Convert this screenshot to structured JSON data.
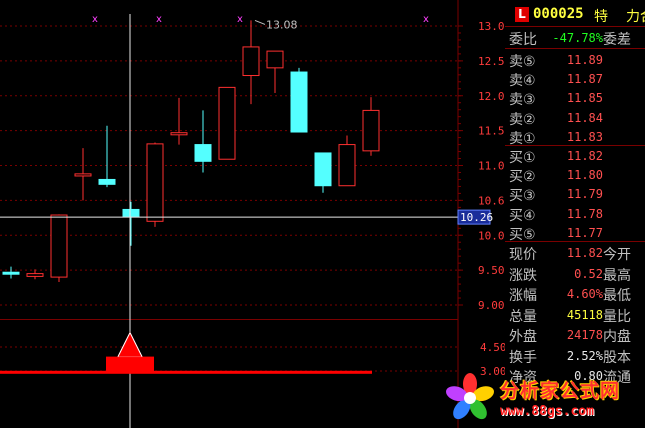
{
  "chart_data": [
    {
      "type": "candlestick",
      "title": "",
      "ylim": [
        8.7,
        13.2
      ],
      "y_ticks": [
        13.0,
        12.5,
        12.0,
        11.5,
        11.0,
        10.5,
        10.0,
        9.5,
        9.0
      ],
      "y_tick_labels": [
        "13.00",
        "12.50",
        "12.00",
        "11.50",
        "11.00",
        "10.60",
        "10.00",
        "9.50",
        "9.00"
      ],
      "crosshair_value": "10.26",
      "high_annotation": "13.08",
      "candles": [
        {
          "o": 9.47,
          "c": 9.47,
          "h": 9.55,
          "l": 9.38,
          "dir": "down"
        },
        {
          "o": 9.41,
          "c": 9.45,
          "h": 9.51,
          "l": 9.37,
          "dir": "up"
        },
        {
          "o": 9.4,
          "c": 10.29,
          "h": 10.3,
          "l": 9.33,
          "dir": "up"
        },
        {
          "o": 10.85,
          "c": 10.88,
          "h": 11.25,
          "l": 10.5,
          "dir": "up"
        },
        {
          "o": 10.8,
          "c": 10.73,
          "h": 11.57,
          "l": 10.69,
          "dir": "down"
        },
        {
          "o": 10.37,
          "c": 10.27,
          "h": 10.48,
          "l": 9.85,
          "dir": "down"
        },
        {
          "o": 10.2,
          "c": 11.31,
          "h": 11.33,
          "l": 10.12,
          "dir": "up"
        },
        {
          "o": 11.44,
          "c": 11.47,
          "h": 11.97,
          "l": 11.3,
          "dir": "up"
        },
        {
          "o": 11.3,
          "c": 11.06,
          "h": 11.79,
          "l": 10.9,
          "dir": "down"
        },
        {
          "o": 11.09,
          "c": 12.12,
          "h": 12.12,
          "l": 11.09,
          "dir": "up"
        },
        {
          "o": 12.29,
          "c": 12.7,
          "h": 13.08,
          "l": 11.88,
          "dir": "up"
        },
        {
          "o": 12.4,
          "c": 12.64,
          "h": 12.64,
          "l": 12.04,
          "dir": "up"
        },
        {
          "o": 12.34,
          "c": 11.48,
          "h": 12.4,
          "l": 11.48,
          "dir": "down"
        },
        {
          "o": 11.18,
          "c": 10.71,
          "h": 11.18,
          "l": 10.61,
          "dir": "down"
        },
        {
          "o": 10.71,
          "c": 11.3,
          "h": 11.43,
          "l": 10.71,
          "dir": "up"
        },
        {
          "o": 11.21,
          "c": 11.79,
          "h": 11.98,
          "l": 11.14,
          "dir": "up"
        }
      ],
      "markers": [
        {
          "index": 2,
          "symbol": "x"
        },
        {
          "index": 7,
          "symbol": "x"
        },
        {
          "index": 10,
          "symbol": "x"
        },
        {
          "index": 18,
          "symbol": "x"
        }
      ]
    },
    {
      "type": "indicator",
      "ylim": [
        2.8,
        5.6
      ],
      "y_tick_labels": [
        "4.50",
        "3.00"
      ],
      "y_ticks": [
        4.5,
        3.0
      ],
      "peak": 5.4,
      "plateau": 3.9,
      "base": 2.95
    }
  ],
  "panel": {
    "stock_code": "000025",
    "stock_flag": "特",
    "stock_name": "力合",
    "badge": "L",
    "weibi_label": "委比",
    "weibi_value": "-47.78%",
    "weicha_label": "委差",
    "sell": [
      {
        "label": "卖⑤",
        "price": "11.89"
      },
      {
        "label": "卖④",
        "price": "11.87"
      },
      {
        "label": "卖③",
        "price": "11.85"
      },
      {
        "label": "卖②",
        "price": "11.84"
      },
      {
        "label": "卖①",
        "price": "11.83"
      }
    ],
    "buy": [
      {
        "label": "买①",
        "price": "11.82"
      },
      {
        "label": "买②",
        "price": "11.80"
      },
      {
        "label": "买③",
        "price": "11.79"
      },
      {
        "label": "买④",
        "price": "11.78"
      },
      {
        "label": "买⑤",
        "price": "11.77"
      }
    ],
    "stats": [
      {
        "label": "现价",
        "value": "11.82",
        "label2": "今开"
      },
      {
        "label": "涨跌",
        "value": "0.52",
        "label2": "最高"
      },
      {
        "label": "涨幅",
        "value": "4.60%",
        "label2": "最低"
      },
      {
        "label": "总量",
        "value": "45118",
        "label2": "量比"
      },
      {
        "label": "外盘",
        "value": "24178",
        "label2": "内盘"
      },
      {
        "label": "换手",
        "value": "2.52%",
        "label2": "股本"
      },
      {
        "label": "净资",
        "value": "0.80",
        "label2": "流通"
      }
    ]
  },
  "watermark": {
    "title": "分析家公式网",
    "url": "www.88gs.com"
  },
  "colors": {
    "up": "#ff3030",
    "down": "#54ffff",
    "grid": "#7a0000",
    "axis_text": "#ff3c3c",
    "crosshair": "#e8e8e8",
    "marker": "#ff40ff"
  }
}
